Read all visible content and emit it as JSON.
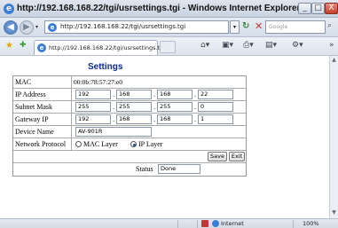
{
  "window": {
    "title": "http://192.168.168.22/tgi/usrsettings.tgi - Windows Internet Explorer",
    "minimize": "_",
    "maximize": "□",
    "close": "X"
  },
  "toolbar": {
    "address": "http://192.168.168.22/tgi/usrsettings.tgi",
    "search_placeholder": "Google",
    "tab_label": "http://192.168.168.22/tgi/usrsettings.tgi"
  },
  "page": {
    "heading": "Settings",
    "mac_label": "MAC",
    "mac_value": "00:0b:78:57:27:e0",
    "ip_label": "IP Address",
    "ip": [
      "192",
      "168",
      "168",
      "22"
    ],
    "mask_label": "Subnet Mask",
    "mask": [
      "255",
      "255",
      "255",
      "0"
    ],
    "gateway_label": "Gateway IP",
    "gateway": [
      "192",
      "168",
      "168",
      "1"
    ],
    "device_name_label": "Device Name",
    "device_name": "AV-901R",
    "protocol_label": "Network Protocol",
    "protocol_options": [
      "MAC Layer",
      "IP Layer"
    ],
    "protocol_selected": "IP Layer",
    "save_label": "Save",
    "exit_label": "Exit",
    "status_label": "Status",
    "status_value": "Done"
  },
  "statusbar": {
    "zone": "Internet",
    "zoom": "100%"
  },
  "icons": {
    "ie": "ie-logo-icon",
    "back": "back-arrow-icon",
    "forward": "forward-arrow-icon",
    "refresh": "refresh-icon",
    "stop": "stop-icon",
    "search": "search-icon",
    "favorites": "star-icon",
    "add_favorite": "add-favorite-icon",
    "home": "home-icon",
    "feeds": "feeds-icon",
    "print": "print-icon",
    "page": "page-menu-icon",
    "tools": "tools-icon"
  }
}
